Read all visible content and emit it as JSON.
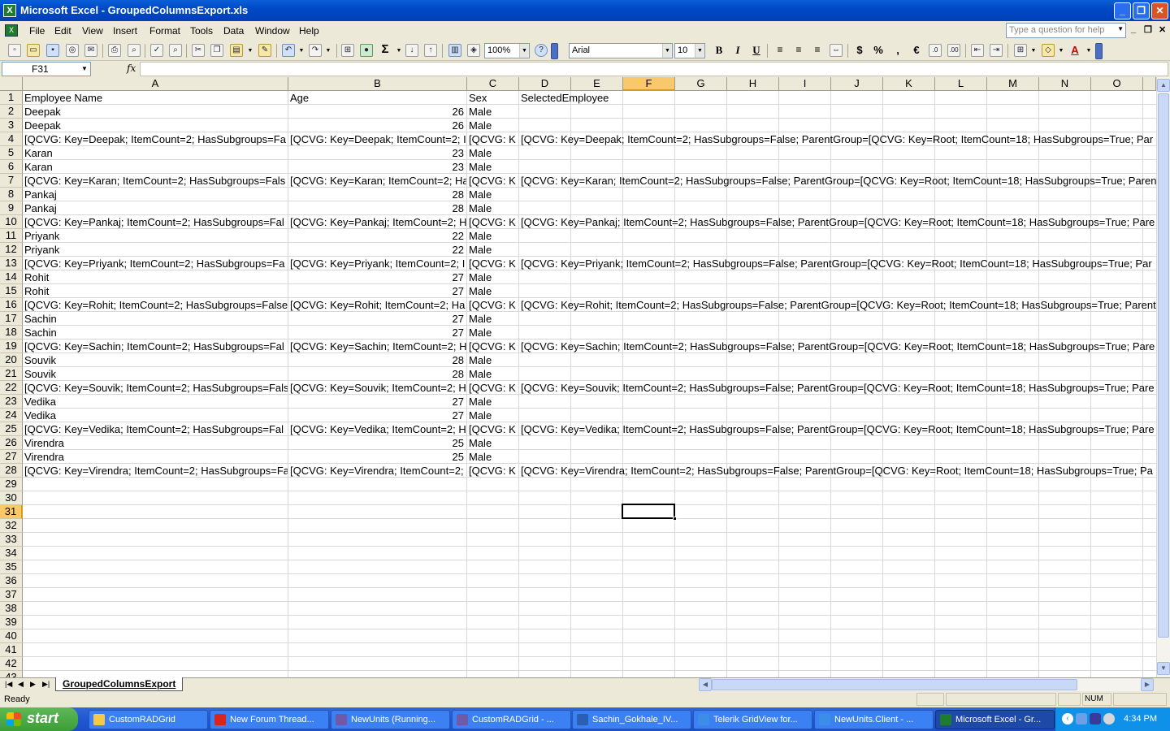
{
  "window": {
    "title": "Microsoft Excel - GroupedColumnsExport.xls",
    "minimize_glyph": "_",
    "restore_glyph": "❐",
    "close_glyph": "✕"
  },
  "menubar": {
    "items": [
      "File",
      "Edit",
      "View",
      "Insert",
      "Format",
      "Tools",
      "Data",
      "Window",
      "Help"
    ],
    "help_placeholder": "Type a question for help"
  },
  "toolbar": {
    "zoom": "100%",
    "font_name": "Arial",
    "font_size": "10",
    "bold": "B",
    "italic": "I",
    "underline": "U",
    "currency": "$",
    "percent": "%",
    "comma": ",",
    "euro": "€",
    "sigma": "Σ"
  },
  "formula_bar": {
    "name_box": "F31",
    "fx": "fx",
    "content": ""
  },
  "grid": {
    "columns": [
      "A",
      "B",
      "C",
      "D",
      "E",
      "F",
      "G",
      "H",
      "I",
      "J",
      "K",
      "L",
      "M",
      "N",
      "O"
    ],
    "selected_column": "F",
    "selected_row": "31",
    "active_cell": "F31",
    "row_numbers": [
      "1",
      "2",
      "3",
      "4",
      "5",
      "6",
      "7",
      "8",
      "9",
      "10",
      "11",
      "12",
      "13",
      "14",
      "15",
      "16",
      "17",
      "18",
      "19",
      "20",
      "21",
      "22",
      "23",
      "24",
      "25",
      "26",
      "27",
      "28",
      "29",
      "30",
      "31",
      "32",
      "33",
      "34",
      "35",
      "36",
      "37",
      "38",
      "39",
      "40",
      "41",
      "42",
      "43"
    ],
    "header": {
      "a": "Employee Name",
      "b": "Age",
      "c": "Sex",
      "d": "SelectedEmployee"
    },
    "rows": [
      {
        "a": "Deepak",
        "b": "26",
        "c": "Male",
        "d": ""
      },
      {
        "a": "Deepak",
        "b": "26",
        "c": "Male",
        "d": ""
      },
      {
        "a": "[QCVG: Key=Deepak; ItemCount=2; HasSubgroups=Fa",
        "b": "[QCVG: Key=Deepak; ItemCount=2; I",
        "c": "[QCVG: K",
        "d": "[QCVG: Key=Deepak; ItemCount=2; HasSubgroups=False; ParentGroup=[QCVG: Key=Root; ItemCount=18; HasSubgroups=True; Par"
      },
      {
        "a": "Karan",
        "b": "23",
        "c": "Male",
        "d": ""
      },
      {
        "a": "Karan",
        "b": "23",
        "c": "Male",
        "d": ""
      },
      {
        "a": "[QCVG: Key=Karan; ItemCount=2; HasSubgroups=Fals",
        "b": "[QCVG: Key=Karan; ItemCount=2; Ha",
        "c": "[QCVG: K",
        "d": "[QCVG: Key=Karan; ItemCount=2; HasSubgroups=False; ParentGroup=[QCVG: Key=Root; ItemCount=18; HasSubgroups=True; Paren"
      },
      {
        "a": "Pankaj",
        "b": "28",
        "c": "Male",
        "d": ""
      },
      {
        "a": "Pankaj",
        "b": "28",
        "c": "Male",
        "d": ""
      },
      {
        "a": "[QCVG: Key=Pankaj; ItemCount=2; HasSubgroups=Fal",
        "b": "[QCVG: Key=Pankaj; ItemCount=2; H",
        "c": "[QCVG: K",
        "d": "[QCVG: Key=Pankaj; ItemCount=2; HasSubgroups=False; ParentGroup=[QCVG: Key=Root; ItemCount=18; HasSubgroups=True; Pare"
      },
      {
        "a": "Priyank",
        "b": "22",
        "c": "Male",
        "d": ""
      },
      {
        "a": "Priyank",
        "b": "22",
        "c": "Male",
        "d": ""
      },
      {
        "a": "[QCVG: Key=Priyank; ItemCount=2; HasSubgroups=Fa",
        "b": "[QCVG: Key=Priyank; ItemCount=2; I",
        "c": "[QCVG: K",
        "d": "[QCVG: Key=Priyank; ItemCount=2; HasSubgroups=False; ParentGroup=[QCVG: Key=Root; ItemCount=18; HasSubgroups=True; Par"
      },
      {
        "a": "Rohit",
        "b": "27",
        "c": "Male",
        "d": ""
      },
      {
        "a": "Rohit",
        "b": "27",
        "c": "Male",
        "d": ""
      },
      {
        "a": "[QCVG: Key=Rohit; ItemCount=2; HasSubgroups=False",
        "b": "[QCVG: Key=Rohit; ItemCount=2; Ha",
        "c": "[QCVG: K",
        "d": "[QCVG: Key=Rohit; ItemCount=2; HasSubgroups=False; ParentGroup=[QCVG: Key=Root; ItemCount=18; HasSubgroups=True; Parent"
      },
      {
        "a": "Sachin",
        "b": "27",
        "c": "Male",
        "d": ""
      },
      {
        "a": "Sachin",
        "b": "27",
        "c": "Male",
        "d": ""
      },
      {
        "a": "[QCVG: Key=Sachin; ItemCount=2; HasSubgroups=Fal",
        "b": "[QCVG: Key=Sachin; ItemCount=2; H",
        "c": "[QCVG: K",
        "d": "[QCVG: Key=Sachin; ItemCount=2; HasSubgroups=False; ParentGroup=[QCVG: Key=Root; ItemCount=18; HasSubgroups=True; Pare"
      },
      {
        "a": "Souvik",
        "b": "28",
        "c": "Male",
        "d": ""
      },
      {
        "a": "Souvik",
        "b": "28",
        "c": "Male",
        "d": ""
      },
      {
        "a": "[QCVG: Key=Souvik; ItemCount=2; HasSubgroups=Fals",
        "b": "[QCVG: Key=Souvik; ItemCount=2; H",
        "c": "[QCVG: K",
        "d": "[QCVG: Key=Souvik; ItemCount=2; HasSubgroups=False; ParentGroup=[QCVG: Key=Root; ItemCount=18; HasSubgroups=True; Pare"
      },
      {
        "a": "Vedika",
        "b": "27",
        "c": "Male",
        "d": ""
      },
      {
        "a": "Vedika",
        "b": "27",
        "c": "Male",
        "d": ""
      },
      {
        "a": "[QCVG: Key=Vedika; ItemCount=2; HasSubgroups=Fal",
        "b": "[QCVG: Key=Vedika; ItemCount=2; H",
        "c": "[QCVG: K",
        "d": "[QCVG: Key=Vedika; ItemCount=2; HasSubgroups=False; ParentGroup=[QCVG: Key=Root; ItemCount=18; HasSubgroups=True; Pare"
      },
      {
        "a": "Virendra",
        "b": "25",
        "c": "Male",
        "d": ""
      },
      {
        "a": "Virendra",
        "b": "25",
        "c": "Male",
        "d": ""
      },
      {
        "a": "[QCVG: Key=Virendra; ItemCount=2; HasSubgroups=Fa",
        "b": "[QCVG: Key=Virendra; ItemCount=2;",
        "c": "[QCVG: K",
        "d": "[QCVG: Key=Virendra; ItemCount=2; HasSubgroups=False; ParentGroup=[QCVG: Key=Root; ItemCount=18; HasSubgroups=True; Pa"
      }
    ]
  },
  "sheet_tabs": {
    "active": "GroupedColumnsExport"
  },
  "status_bar": {
    "ready": "Ready",
    "num": "NUM"
  },
  "taskbar": {
    "start": "start",
    "tasks": [
      {
        "label": "CustomRADGrid",
        "color": "#f5c84a"
      },
      {
        "label": "New Forum Thread...",
        "color": "#d9251d"
      },
      {
        "label": "NewUnits (Running...",
        "color": "#6d5aa8"
      },
      {
        "label": "CustomRADGrid - ...",
        "color": "#6d5aa8"
      },
      {
        "label": "Sachin_Gokhale_IV...",
        "color": "#2b5fb4"
      },
      {
        "label": "Telerik GridView for...",
        "color": "#3c8de8"
      },
      {
        "label": "NewUnits.Client - ...",
        "color": "#3c8de8"
      },
      {
        "label": "Microsoft Excel - Gr...",
        "color": "#1e7b2f"
      }
    ],
    "clock": "4:34 PM"
  }
}
